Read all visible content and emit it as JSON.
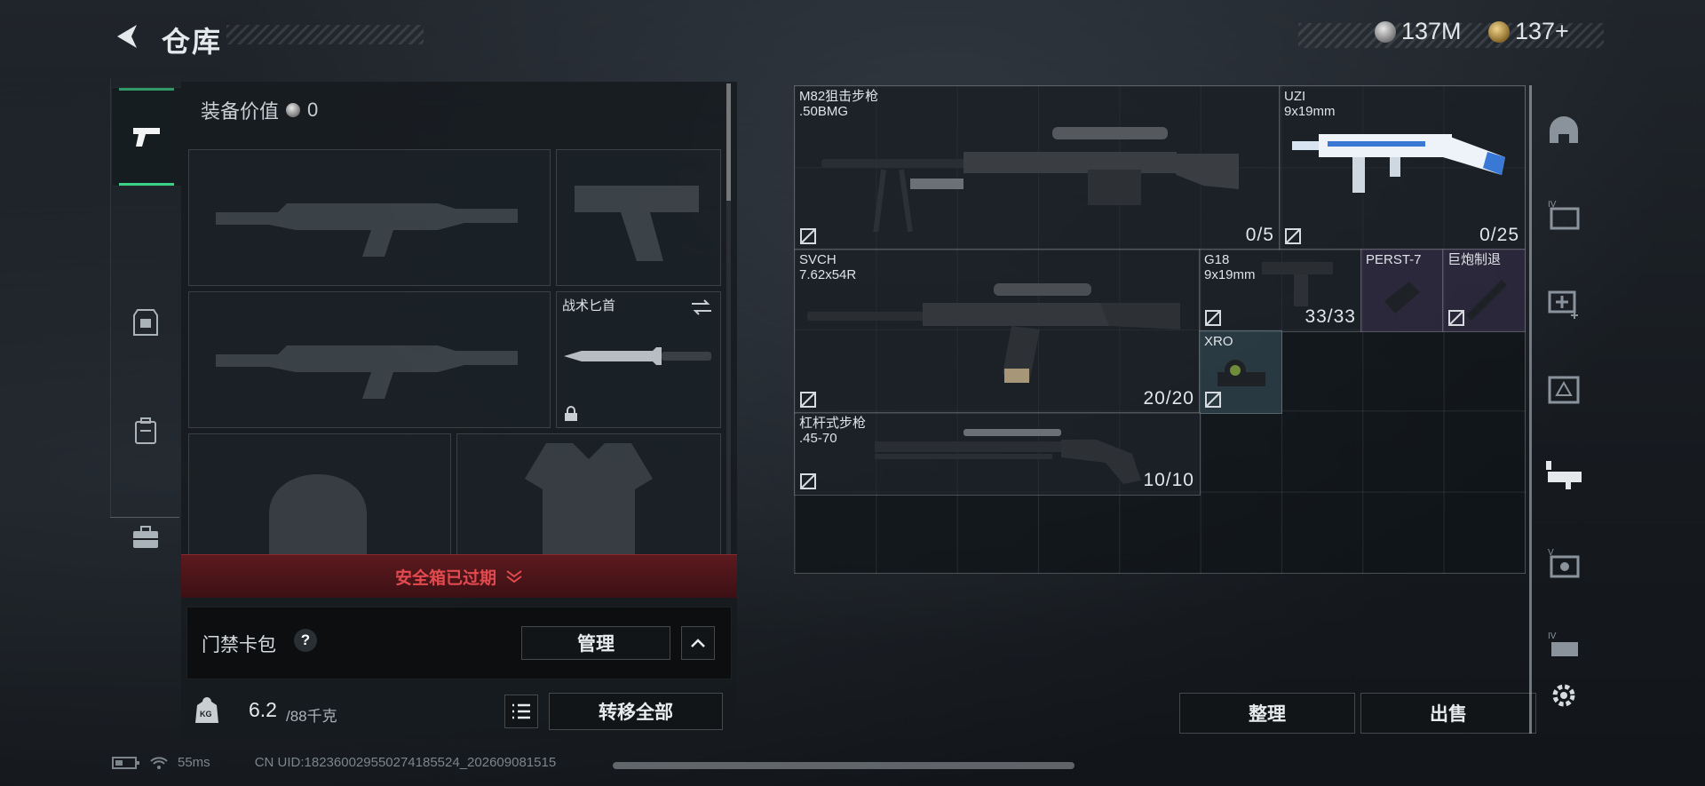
{
  "header": {
    "title": "仓库"
  },
  "currency": [
    {
      "name": "silver-coin-icon",
      "value": "137M"
    },
    {
      "name": "gold-coin-icon",
      "value": "137+"
    }
  ],
  "loadout": {
    "value_label": "装备价值",
    "value": "0",
    "knife_slot_label": "战术匕首",
    "secure_box_text": "安全箱已过期",
    "keycard_label": "门禁卡包",
    "help_symbol": "?",
    "manage_label": "管理",
    "weight_current": "6.2",
    "weight_max": "/88千克",
    "transfer_all_label": "转移全部",
    "weight_icon_text": "KG"
  },
  "stash": {
    "items": [
      {
        "name": "M82狙击步枪",
        "caliber": ".50BMG",
        "ammo": "0/5"
      },
      {
        "name": "UZI",
        "caliber": "9x19mm",
        "ammo": "0/25"
      },
      {
        "name": "SVCH",
        "caliber": "7.62x54R",
        "ammo": "20/20"
      },
      {
        "name": "G18",
        "caliber": "9x19mm",
        "ammo": "33/33"
      },
      {
        "name": "PERST-7",
        "caliber": "",
        "ammo": ""
      },
      {
        "name": "巨炮制退",
        "caliber": "",
        "ammo": ""
      },
      {
        "name": "XRO",
        "caliber": "",
        "ammo": ""
      },
      {
        "name": "杠杆式步枪",
        "caliber": ".45-70",
        "ammo": "10/10"
      }
    ],
    "sort_label": "整理",
    "sell_label": "出售"
  },
  "right_rail": [
    "helmet-tab-icon",
    "armor-iv-tab-icon",
    "medkit-tab-icon",
    "armor-rig-tab-icon",
    "weapon-tab-icon",
    "rig-v-tab-icon",
    "rig-iv-tab-icon",
    "settings-icon"
  ],
  "status_bar": {
    "ping": "55ms",
    "uid": "CN UID:18236002955027418552​4_202609081515"
  },
  "colors": {
    "accent_green": "#3ccf86",
    "warning_red": "#e34a4f"
  }
}
